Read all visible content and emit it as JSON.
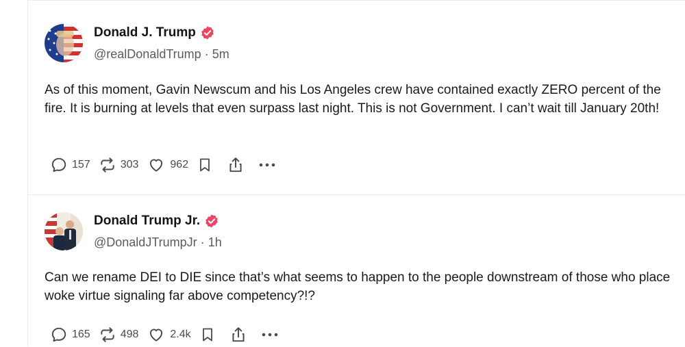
{
  "posts": [
    {
      "display_name": "Donald J. Trump",
      "handle": "@realDonaldTrump",
      "separator": "·",
      "time": "5m",
      "text": "As of this moment, Gavin Newscum and his Los Angeles crew have contained exactly ZERO percent of the fire. It is burning at levels that even surpass last night. This is not Government. I can’t wait till January 20th!",
      "replies": "157",
      "reposts": "303",
      "likes": "962"
    },
    {
      "display_name": "Donald Trump Jr.",
      "handle": "@DonaldJTrumpJr",
      "separator": "·",
      "time": "1h",
      "text": "Can we rename DEI to DIE since that’s what seems to happen to the people downstream of those who place woke virtue signaling far above competency?!?",
      "replies": "165",
      "reposts": "498",
      "likes": "2.4k"
    }
  ],
  "icons": {
    "verified": "verified-badge-icon",
    "reply": "reply-bubble-icon",
    "repost": "repost-arrows-icon",
    "like": "heart-icon",
    "bookmark": "bookmark-icon",
    "share": "share-icon",
    "more": "more-dots-icon"
  },
  "colors": {
    "verified": "#ee4466",
    "text": "#1a1a1a",
    "muted": "#5b5b5b",
    "icon": "#4a4a4a",
    "divider": "#ececec"
  }
}
